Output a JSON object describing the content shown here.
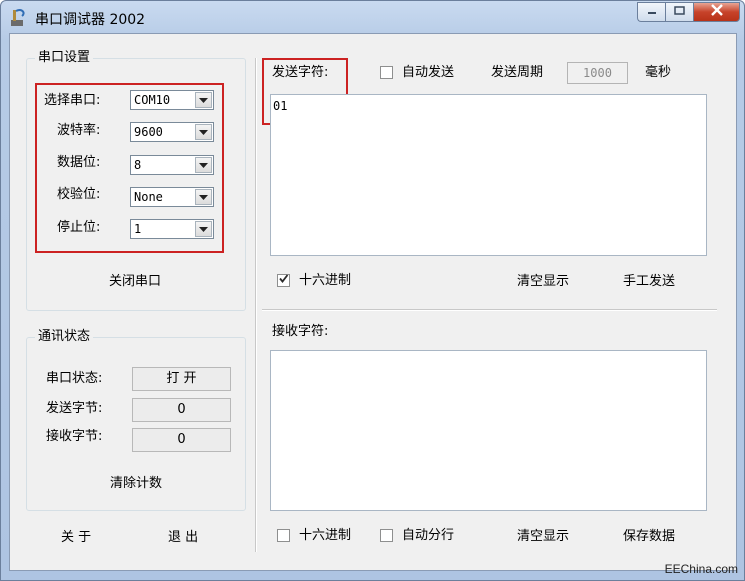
{
  "window": {
    "title": "串口调试器 2002",
    "controls": {
      "minimize_icon": "minimize-icon",
      "maximize_icon": "maximize-icon",
      "close_icon": "close-icon"
    }
  },
  "serial_settings": {
    "group_title": "串口设置",
    "fields": [
      {
        "label": "选择串口:",
        "value": "COM10"
      },
      {
        "label": "波特率:",
        "value": "9600"
      },
      {
        "label": "数据位:",
        "value": "8"
      },
      {
        "label": "校验位:",
        "value": "None"
      },
      {
        "label": "停止位:",
        "value": "1"
      }
    ],
    "close_port_label": "关闭串口"
  },
  "comm_status": {
    "group_title": "通讯状态",
    "port_status_label": "串口状态:",
    "port_status_value": "打 开",
    "sent_bytes_label": "发送字节:",
    "sent_bytes_value": "0",
    "recv_bytes_label": "接收字节:",
    "recv_bytes_value": "0",
    "clear_count_label": "清除计数"
  },
  "footer_left": {
    "about_label": "关 于",
    "exit_label": "退 出"
  },
  "send": {
    "label": "发送字符:",
    "auto_send_label": "自动发送",
    "auto_send_checked": false,
    "period_label": "发送周期",
    "period_value": "1000",
    "period_unit": "毫秒",
    "content": "01",
    "hex_label": "十六进制",
    "hex_checked": true,
    "clear_label": "清空显示",
    "manual_send_label": "手工发送"
  },
  "receive": {
    "label": "接收字符:",
    "content": "",
    "hex_label": "十六进制",
    "hex_checked": false,
    "auto_wrap_label": "自动分行",
    "auto_wrap_checked": false,
    "clear_label": "清空显示",
    "save_label": "保存数据"
  },
  "watermark": "EEChina.com",
  "colors": {
    "highlight_red": "#cc2222",
    "close_button": "#c7432a"
  }
}
